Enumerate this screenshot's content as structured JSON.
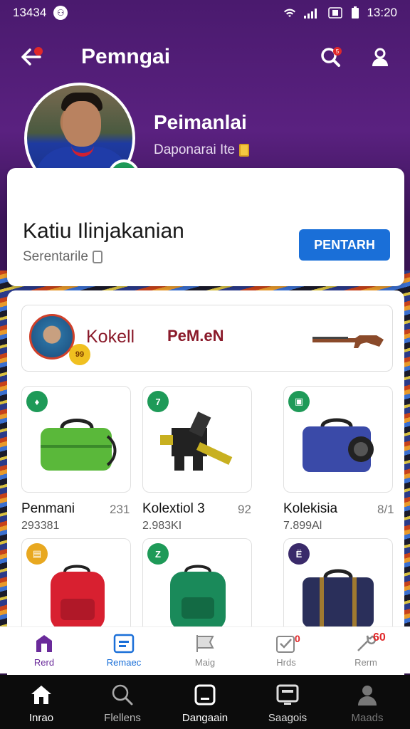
{
  "status": {
    "time": "13434",
    "right_time": "13:20"
  },
  "appbar": {
    "title": "Pemngai",
    "back_icon": "back-arrow-icon",
    "search_icon": "search-icon",
    "profile_icon": "person-icon"
  },
  "profile": {
    "name": "Peimanlai",
    "subtitle": "Daponarai Ite"
  },
  "card": {
    "title": "Katiu Ilinjakanian",
    "subtitle": "Serentarile",
    "button": "PENTARH"
  },
  "featured": {
    "text1": "Kokell",
    "text2": "PeM.eN",
    "coin": "99"
  },
  "items": [
    {
      "label": "Penmani",
      "count": "231",
      "value": "293381",
      "tag_color": "#1e9a58",
      "tag": "♦"
    },
    {
      "label": "Kolextiol 3",
      "count": "92",
      "value": "2.983KI",
      "tag_color": "#1e9a58",
      "tag": "7"
    },
    {
      "label": "Kolekisia",
      "count": "8/1",
      "value": "7.899Al",
      "tag_color": "#1e9a58",
      "tag": "▣"
    },
    {
      "label": "",
      "count": "",
      "value": "",
      "tag_color": "#e8a820",
      "tag": "▤"
    },
    {
      "label": "",
      "count": "",
      "value": "",
      "tag_color": "#1e9a58",
      "tag": "Z"
    },
    {
      "label": "",
      "count": "",
      "value": "",
      "tag_color": "#3a2a6a",
      "tag": "Ё"
    }
  ],
  "subtabs": [
    {
      "label": "Rerd",
      "icon": "home-shield-icon",
      "color": "#6a2a9a"
    },
    {
      "label": "Remaec",
      "icon": "list-icon",
      "color": "#1a6fd8"
    },
    {
      "label": "Maig",
      "icon": "flag-icon",
      "color": "#888"
    },
    {
      "label": "Hrds",
      "icon": "check-icon",
      "color": "#888",
      "badge": "0"
    },
    {
      "label": "Rerm",
      "icon": "wrench-icon",
      "color": "#888",
      "badge": "60"
    }
  ],
  "nav": [
    {
      "label": "Inrao",
      "icon": "home-icon"
    },
    {
      "label": "Flellens",
      "icon": "search-icon"
    },
    {
      "label": "Dangaain",
      "icon": "square-icon"
    },
    {
      "label": "Saagois",
      "icon": "monitor-icon"
    },
    {
      "label": "Maads",
      "icon": "person-icon"
    }
  ]
}
